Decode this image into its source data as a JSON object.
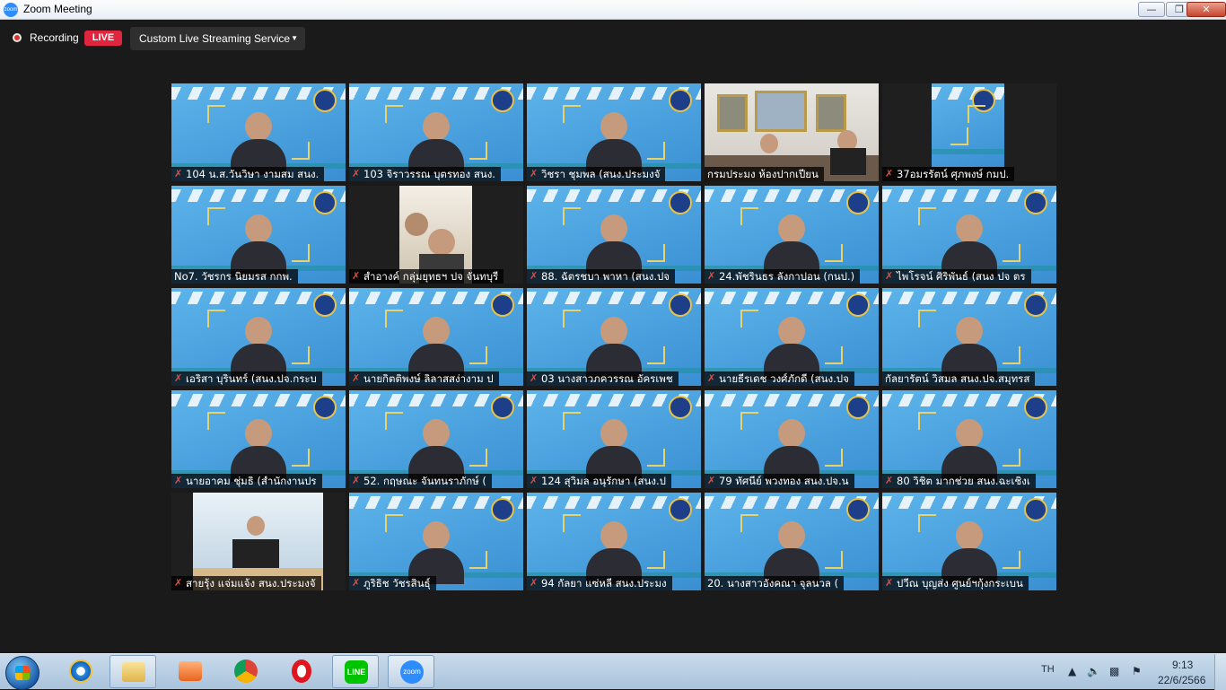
{
  "window": {
    "app_icon": "zoom",
    "title": "Zoom Meeting",
    "minimize_icon": "minimize-icon",
    "restore_icon": "restore-icon",
    "close_icon": "close-icon"
  },
  "recording": {
    "label": "Recording",
    "live_badge": "LIVE",
    "stream_service": "Custom Live Streaming Service"
  },
  "colors": {
    "active_speaker_border": "#c6e35d",
    "live_red": "#e0263f",
    "tile_bg_blue": "#4aa3df",
    "mute_red": "#e74c3c"
  },
  "participants": [
    {
      "name": "104 น.ส.วันวิษา งามสม สนง.",
      "muted": true,
      "video": "virtual-bg"
    },
    {
      "name": "103 จิราวรรณ บุตรทอง สนง.",
      "muted": true,
      "video": "virtual-bg"
    },
    {
      "name": "วิชรา ชุมพล (สนง.ประมงจั",
      "muted": true,
      "video": "virtual-bg"
    },
    {
      "name": "กรมประมง ห้องปากเปียน",
      "muted": false,
      "video": "room",
      "active": true
    },
    {
      "name": "37อมรรัตน์ ศุภพงษ์ กมป.",
      "muted": true,
      "video": "virtual-bg-small"
    },
    {
      "name": "No7. วัชรกร นิยมรส กกพ.",
      "muted": false,
      "video": "virtual-bg"
    },
    {
      "name": "สำอางค์ กลุ่มยุทธฯ ปจ จันทบุรี",
      "muted": true,
      "video": "camera"
    },
    {
      "name": "88. ฉัตรชบา พาหา (สนง.ปจ",
      "muted": true,
      "video": "virtual-bg"
    },
    {
      "name": "24.พัชรินธร ลังกาปอน (กนป.)",
      "muted": true,
      "video": "virtual-bg"
    },
    {
      "name": "ไพโรจน์ ศิริพันธ์ (สนง ปจ ตร",
      "muted": true,
      "video": "virtual-bg"
    },
    {
      "name": "เอริสา บุรินทร์ (สนง.ปจ.กระบ",
      "muted": true,
      "video": "virtual-bg"
    },
    {
      "name": "นายกิตติพงษ์ ลิลาสสง่างาม ป",
      "muted": true,
      "video": "virtual-bg"
    },
    {
      "name": "03 นางสาวภควรรณ อัครเพช",
      "muted": true,
      "video": "virtual-bg"
    },
    {
      "name": "นายธีรเดช วงศ์ภักดี (สนง.ปจ",
      "muted": true,
      "video": "virtual-bg"
    },
    {
      "name": "กัลยารัตน์ วิสมล สนง.ปจ.สมุทรส",
      "muted": false,
      "video": "virtual-bg"
    },
    {
      "name": "นายอาคม ชุ่มธิ (สำนักงานปร",
      "muted": true,
      "video": "virtual-bg"
    },
    {
      "name": "52. กฤษณะ จันทนราภักษ์ (",
      "muted": true,
      "video": "virtual-bg"
    },
    {
      "name": "124 สุวิมล อนุรักษา (สนง.ป",
      "muted": true,
      "video": "virtual-bg"
    },
    {
      "name": "79 ทัศนีย์ พวงทอง สนง.ปจ.น",
      "muted": true,
      "video": "virtual-bg"
    },
    {
      "name": "80 วิชิต มากช่วย สนง.ฉะเชิงเ",
      "muted": true,
      "video": "virtual-bg"
    },
    {
      "name": "สายรุ้ง แจ่มแจ้ง สนง.ประมงจั",
      "muted": true,
      "video": "camera-small"
    },
    {
      "name": "ภูริธิช วัชรสินธุ์",
      "muted": true,
      "video": "virtual-bg"
    },
    {
      "name": "94 กัลยา แซ่หลี สนง.ประมง",
      "muted": true,
      "video": "virtual-bg"
    },
    {
      "name": "20. นางสาวอังคณา จุลนวล (",
      "muted": false,
      "video": "virtual-bg"
    },
    {
      "name": "ปวีณ บุญส่ง ศูนย์ฯกุ้งกระเบน",
      "muted": true,
      "video": "virtual-bg"
    }
  ],
  "taskbar": {
    "items": [
      "ie-icon",
      "folder-icon",
      "media-player-icon",
      "chrome-icon",
      "opera-icon",
      "line-icon",
      "zoom-icon"
    ],
    "line_label": "LINE",
    "zoom_label": "zoom",
    "language": "TH",
    "time": "9:13",
    "date": "22/6/2566"
  }
}
